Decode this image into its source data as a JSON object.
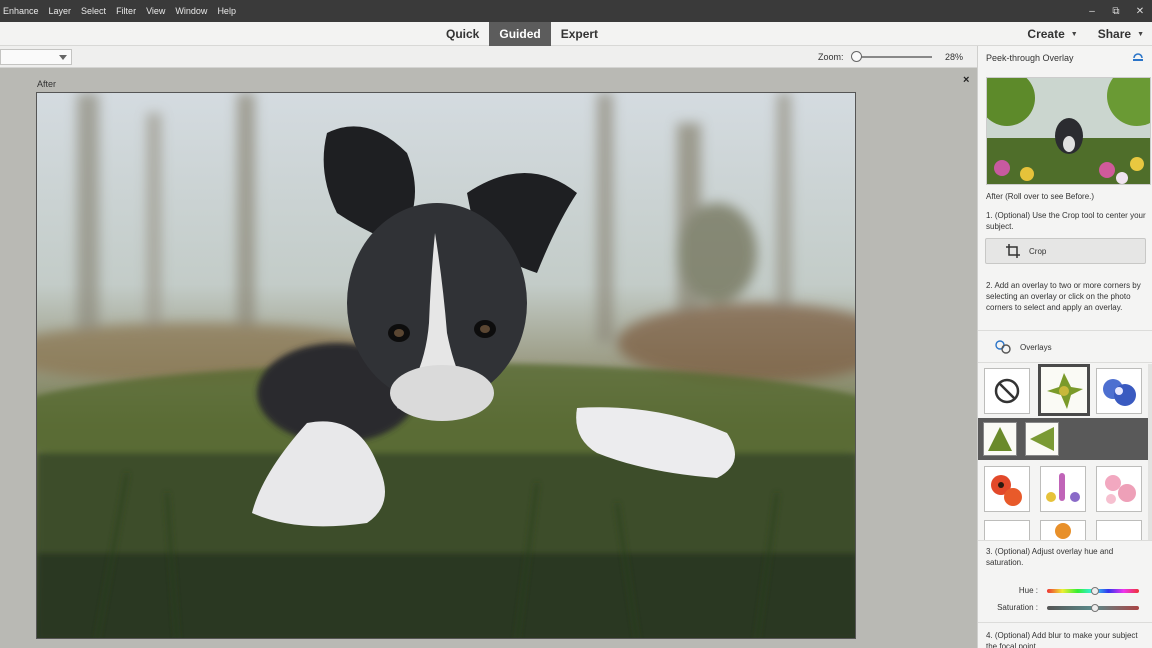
{
  "menu": {
    "items": [
      "Enhance",
      "Layer",
      "Select",
      "Filter",
      "View",
      "Window",
      "Help"
    ]
  },
  "window_controls": {
    "minimize": "–",
    "restore": "⧉",
    "close": "✕"
  },
  "modes": {
    "tabs": [
      "Quick",
      "Guided",
      "Expert"
    ],
    "active": "Guided",
    "create_label": "Create",
    "share_label": "Share"
  },
  "options": {
    "zoom_label": "Zoom:",
    "zoom_value": "28%",
    "zoom_level": 0.05
  },
  "canvas": {
    "view_label": "After",
    "close_glyph": "×"
  },
  "panel": {
    "title": "Peek-through Overlay",
    "preview_caption": "After (Roll over to see Before.)",
    "step1": "1. (Optional) Use the Crop tool to center your subject.",
    "crop_label": "Crop",
    "step2": "2. Add an overlay to two or more corners by selecting an overlay or click on the photo corners to select and apply an overlay.",
    "overlays_label": "Overlays",
    "step3": "3. (Optional) Adjust overlay hue and saturation.",
    "hue_label": "Hue :",
    "saturation_label": "Saturation :",
    "hue_level": 0.52,
    "saturation_level": 0.52,
    "step4": "4. (Optional) Add blur to make your subject the focal point."
  },
  "colors": {
    "menubar": "#3a3a3a",
    "active_tab": "#5c5c5c",
    "canvas_bg": "#b9b9b4",
    "panel_bg": "#f4f4f3"
  }
}
